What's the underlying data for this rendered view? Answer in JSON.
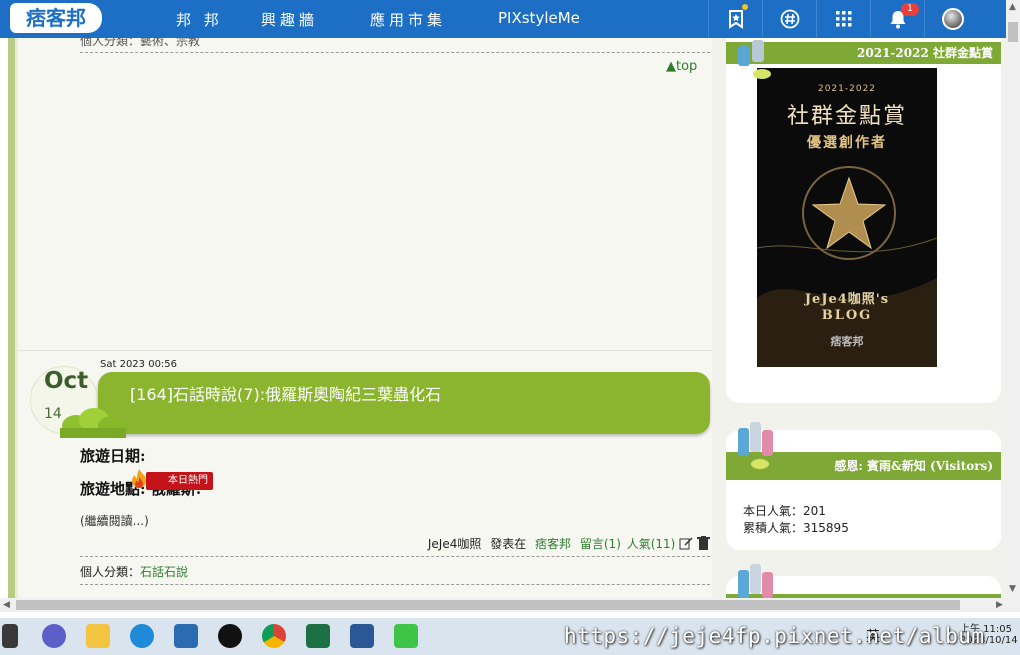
{
  "topbar": {
    "logo": "痞客邦",
    "nav": [
      "邦 邦",
      "興趣牆",
      "應用市集",
      "PIXstyleMe"
    ],
    "notification_count": "1"
  },
  "main": {
    "prev_category_partial": "個人分類：藝術、宗教",
    "top_link": "▲top",
    "post": {
      "date_line": "Sat 2023 00:56",
      "month": "Oct",
      "day": "14",
      "title": "[164]石話時說(7):俄羅斯奧陶紀三葉蟲化石",
      "line1": "旅遊日期:",
      "line2": "旅遊地點: 俄羅斯:",
      "hot_badge": "本日熱門",
      "read_more": "(繼續閱讀...)",
      "author": "JeJe4咖照",
      "posted_at": "發表在",
      "platform": "痞客邦",
      "comments": "留言(1)",
      "views": "人氣(11)",
      "category_label": "個人分類：",
      "category": "石話石說"
    }
  },
  "sidebar": {
    "award_card": {
      "heading": "2021-2022 社群金點賞",
      "image_year": "2021-2022",
      "image_title": "社群金點賞",
      "image_subtitle": "優選創作者",
      "image_blog_line1": "JeJe4咖照's",
      "image_blog_line2": "BLOG",
      "image_brand": "痞客邦"
    },
    "visitors_card": {
      "heading": "感恩: 賓雨&新知 (Visitors)",
      "today_label": "本日人氣：",
      "today": "201",
      "total_label": "累積人氣：",
      "total": "315895"
    }
  },
  "taskbar": {
    "url_overlay": "https://jeje4fp.pixnet.net/album",
    "ime": "英",
    "clock_time": "上午 11:05",
    "clock_date": "2023/10/14"
  }
}
